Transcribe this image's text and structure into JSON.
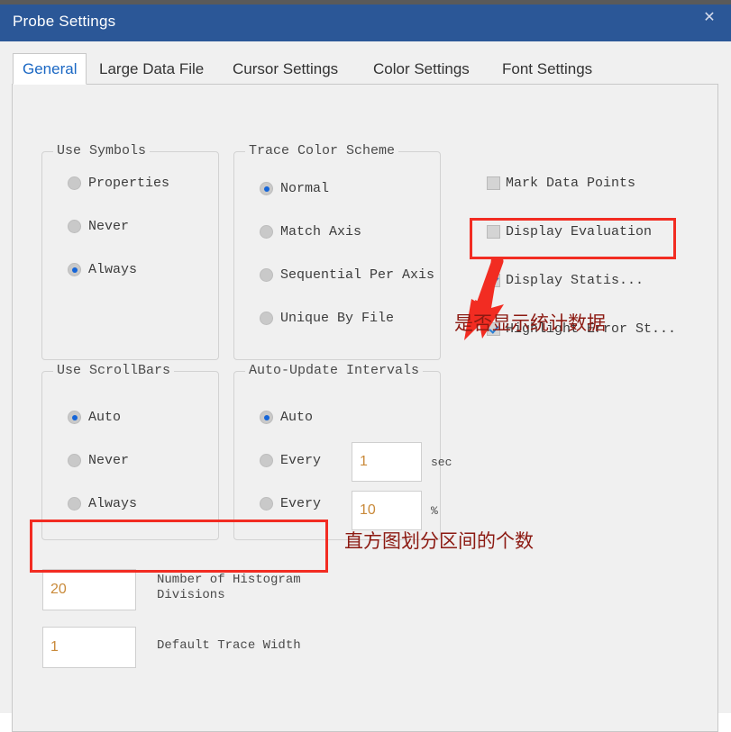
{
  "window": {
    "title": "Probe Settings",
    "close_icon": "close-icon",
    "close_glyph": "✕",
    "accent_color": "#2b5797"
  },
  "tabs": [
    {
      "label": "General",
      "active": true
    },
    {
      "label": "Large Data File",
      "active": false
    },
    {
      "label": "Cursor Settings",
      "active": false
    },
    {
      "label": "Color Settings",
      "active": false
    },
    {
      "label": "Font Settings",
      "active": false
    }
  ],
  "groups": {
    "use_symbols": {
      "title": "Use Symbols",
      "options": [
        {
          "label": "Properties",
          "checked": false
        },
        {
          "label": "Never",
          "checked": false
        },
        {
          "label": "Always",
          "checked": true
        }
      ]
    },
    "trace_color_scheme": {
      "title": "Trace Color Scheme",
      "options": [
        {
          "label": "Normal",
          "checked": true
        },
        {
          "label": "Match Axis",
          "checked": false
        },
        {
          "label": "Sequential Per Axis",
          "checked": false
        },
        {
          "label": "Unique By File",
          "checked": false
        }
      ]
    },
    "use_scrollbars": {
      "title": "Use ScrollBars",
      "options": [
        {
          "label": "Auto",
          "checked": true
        },
        {
          "label": "Never",
          "checked": false
        },
        {
          "label": "Always",
          "checked": false
        }
      ]
    },
    "auto_update_intervals": {
      "title": "Auto-Update Intervals",
      "options": [
        {
          "label": "Auto",
          "checked": true
        },
        {
          "label": "Every",
          "checked": false
        },
        {
          "label": "Every",
          "checked": false
        }
      ],
      "interval_sec_value": "1",
      "interval_sec_unit": "sec",
      "interval_pct_value": "10",
      "interval_pct_unit": "%"
    }
  },
  "checkboxes": [
    {
      "label": "Mark Data Points",
      "checked": false
    },
    {
      "label": "Display Evaluation",
      "checked": false
    },
    {
      "label": "Display Statis...",
      "checked": true
    },
    {
      "label": "Highlight Error St...",
      "checked": true
    }
  ],
  "fields": [
    {
      "value": "20",
      "label": "Number of Histogram\nDivisions"
    },
    {
      "value": "1",
      "label": "Default Trace Width"
    }
  ],
  "annotations": {
    "box_color": "#f22c22",
    "text_color": "#8c1a12",
    "statistics_note": "是否显示统计数据",
    "histogram_note": "直方图划分区间的个数"
  }
}
